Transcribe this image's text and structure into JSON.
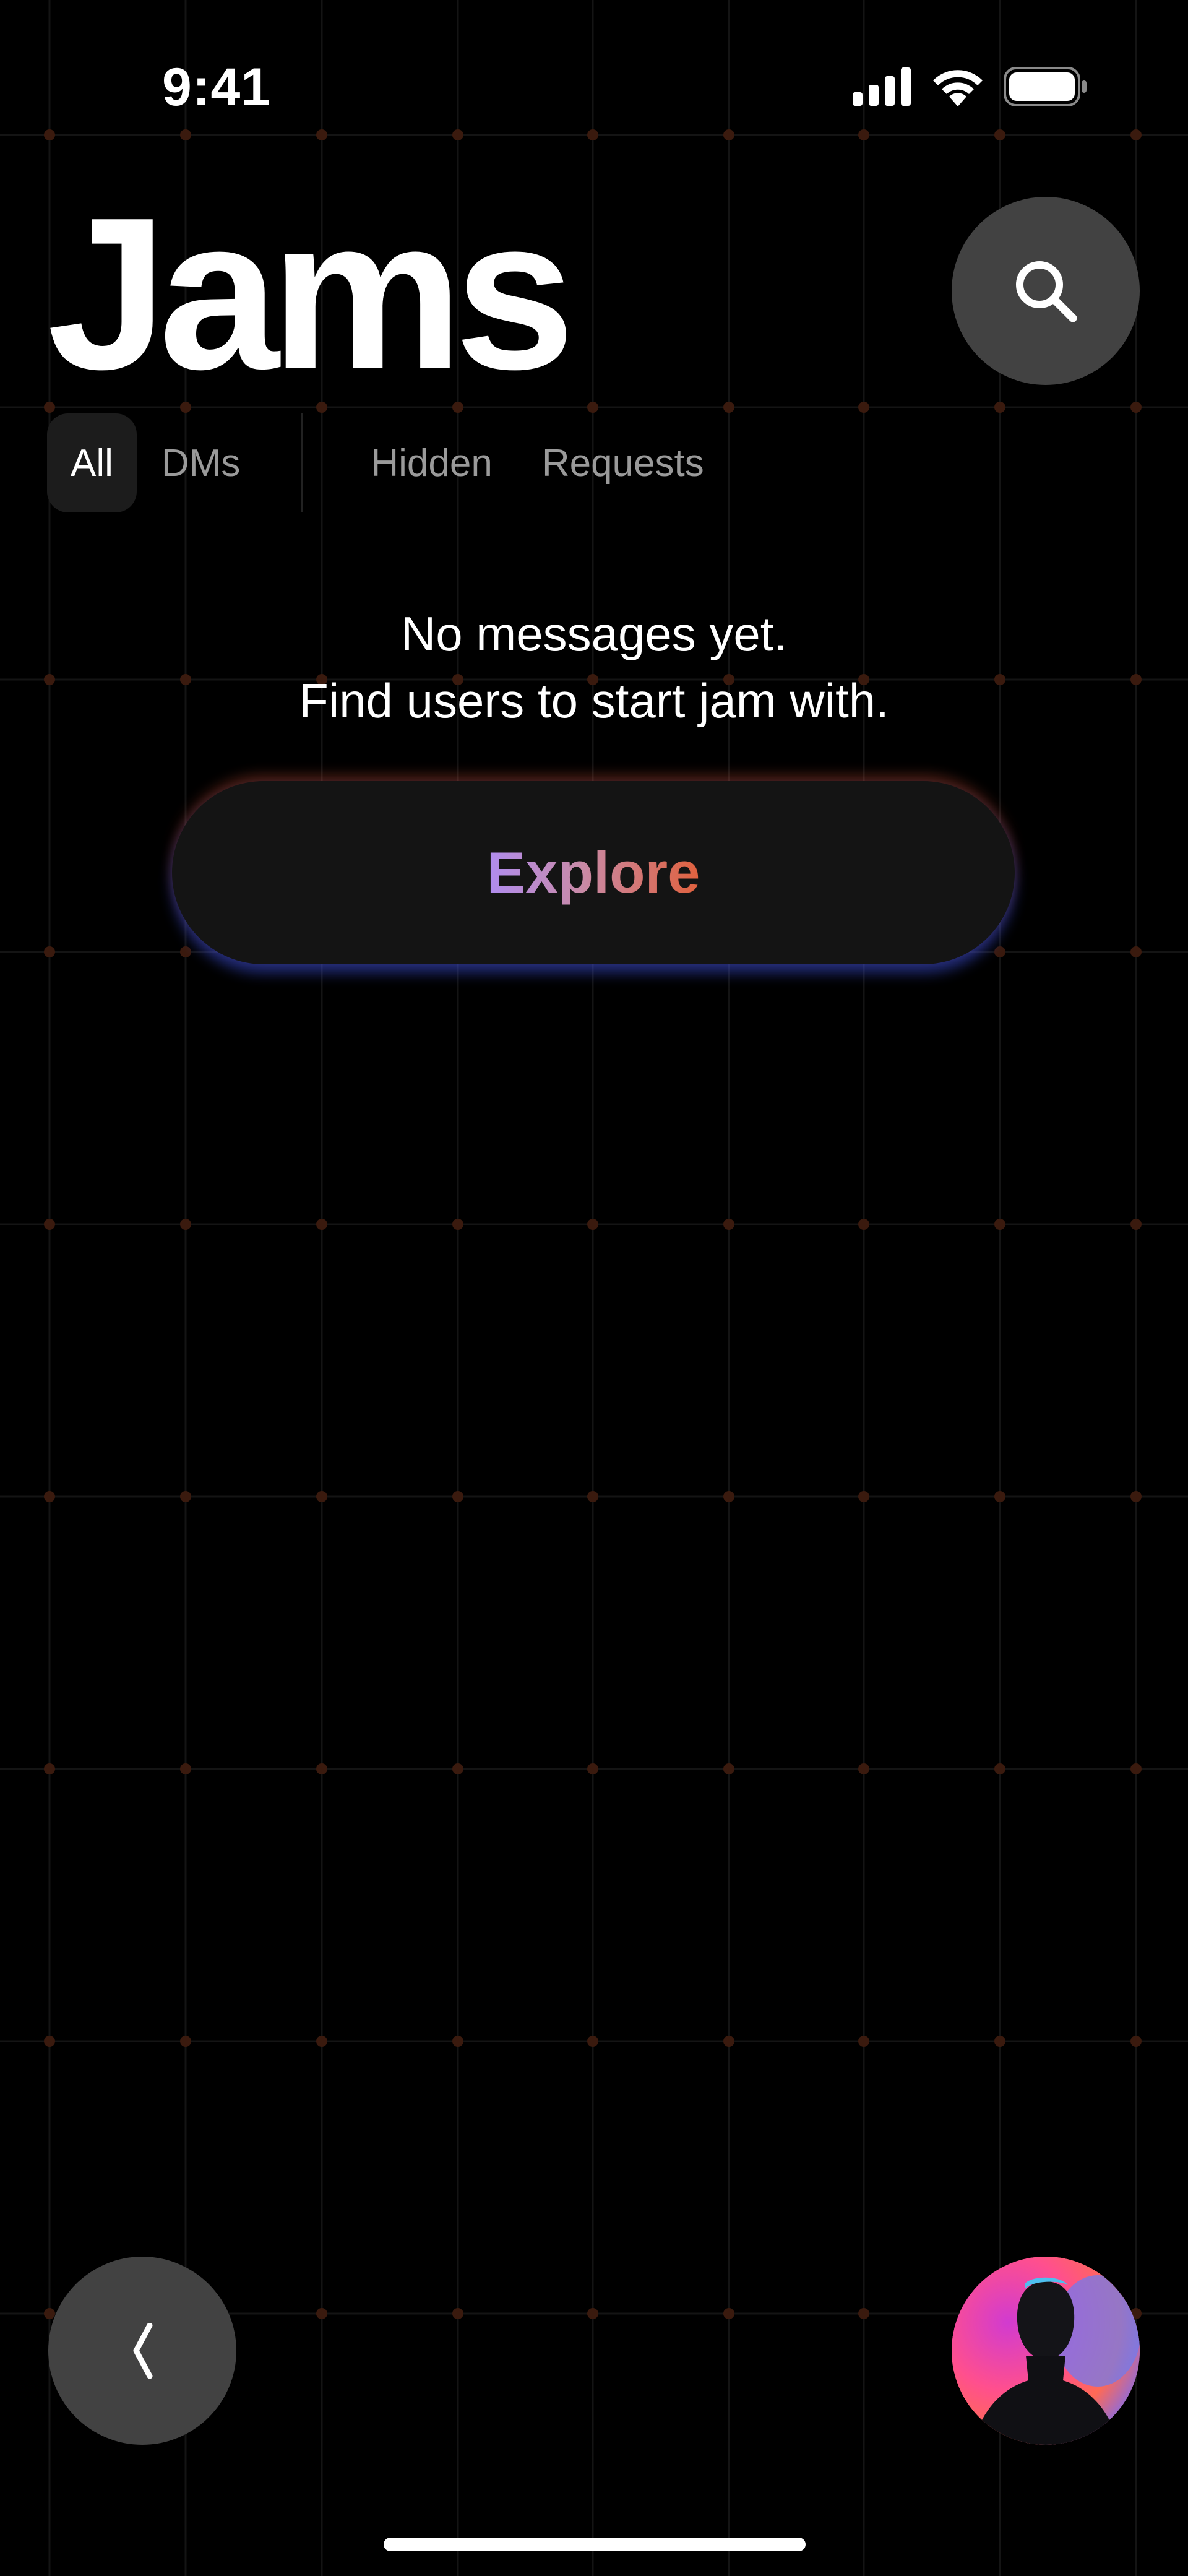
{
  "status_bar": {
    "time": "9:41",
    "icons": [
      "cellular-signal-icon",
      "wifi-icon",
      "battery-icon"
    ]
  },
  "header": {
    "title": "Jams",
    "search_icon": "search-icon"
  },
  "tabs": [
    {
      "label": "All",
      "active": true
    },
    {
      "label": "DMs",
      "active": false
    },
    {
      "label": "Hidden",
      "active": false
    },
    {
      "label": "Requests",
      "active": false
    }
  ],
  "empty_state": {
    "line1": "No messages yet.",
    "line2": "Find users to start jam with.",
    "button_label": "Explore"
  },
  "bottom": {
    "back_icon": "chevron-left-icon",
    "avatar_icon": "user-avatar"
  },
  "colors": {
    "background": "#000000",
    "button_gray": "#424242",
    "grid_dot": "#3a1a0e",
    "explore_gradient_start": "#b08cf0",
    "explore_gradient_end": "#e0613e",
    "explore_glow": "#3c50dc"
  }
}
